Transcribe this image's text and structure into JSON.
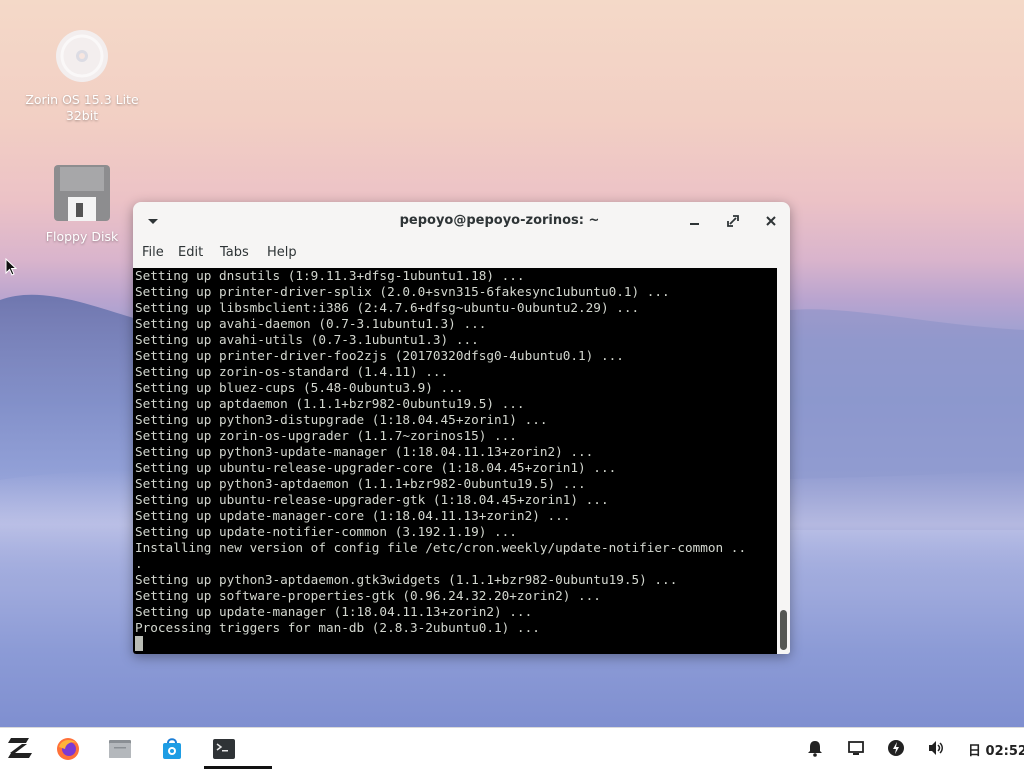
{
  "desktop": {
    "icons": [
      {
        "label_line1": "Zorin OS 15.3 Lite",
        "label_line2": "32bit",
        "icon": "optical-disc-icon"
      },
      {
        "label_line1": "Floppy Disk",
        "icon": "floppy-disk-icon"
      }
    ]
  },
  "terminal": {
    "title": "pepoyo@pepoyo-zorinos: ~",
    "menu": [
      "File",
      "Edit",
      "Tabs",
      "Help"
    ],
    "lines": [
      "Setting up dnsutils (1:9.11.3+dfsg-1ubuntu1.18) ...",
      "Setting up printer-driver-splix (2.0.0+svn315-6fakesync1ubuntu0.1) ...",
      "Setting up libsmbclient:i386 (2:4.7.6+dfsg~ubuntu-0ubuntu2.29) ...",
      "Setting up avahi-daemon (0.7-3.1ubuntu1.3) ...",
      "Setting up avahi-utils (0.7-3.1ubuntu1.3) ...",
      "Setting up printer-driver-foo2zjs (20170320dfsg0-4ubuntu0.1) ...",
      "Setting up zorin-os-standard (1.4.11) ...",
      "Setting up bluez-cups (5.48-0ubuntu3.9) ...",
      "Setting up aptdaemon (1.1.1+bzr982-0ubuntu19.5) ...",
      "Setting up python3-distupgrade (1:18.04.45+zorin1) ...",
      "Setting up zorin-os-upgrader (1.1.7~zorinos15) ...",
      "Setting up python3-update-manager (1:18.04.11.13+zorin2) ...",
      "Setting up ubuntu-release-upgrader-core (1:18.04.45+zorin1) ...",
      "Setting up python3-aptdaemon (1.1.1+bzr982-0ubuntu19.5) ...",
      "Setting up ubuntu-release-upgrader-gtk (1:18.04.45+zorin1) ...",
      "Setting up update-manager-core (1:18.04.11.13+zorin2) ...",
      "Setting up update-notifier-common (3.192.1.19) ...",
      "Installing new version of config file /etc/cron.weekly/update-notifier-common ..",
      ".",
      "Setting up python3-aptdaemon.gtk3widgets (1.1.1+bzr982-0ubuntu19.5) ...",
      "Setting up software-properties-gtk (0.96.24.32.20+zorin2) ...",
      "Setting up update-manager (1:18.04.11.13+zorin2) ...",
      "Processing triggers for man-db (2.8.3-2ubuntu0.1) ..."
    ],
    "buttons": [
      "minimize-icon",
      "maximize-icon",
      "close-icon"
    ]
  },
  "taskbar": {
    "apps": [
      "zorin-menu-icon",
      "firefox-icon",
      "files-icon",
      "software-store-icon",
      "terminal-icon"
    ],
    "active_app": "terminal-icon",
    "tray": [
      "notification-bell-icon",
      "display-icon",
      "power-icon",
      "volume-icon"
    ],
    "date_glyph": "日",
    "clock": "02:52"
  },
  "colors": {
    "terminal_bg": "#000000",
    "terminal_fg": "#d3d7cf",
    "taskbar_bg": "#ffffff"
  }
}
